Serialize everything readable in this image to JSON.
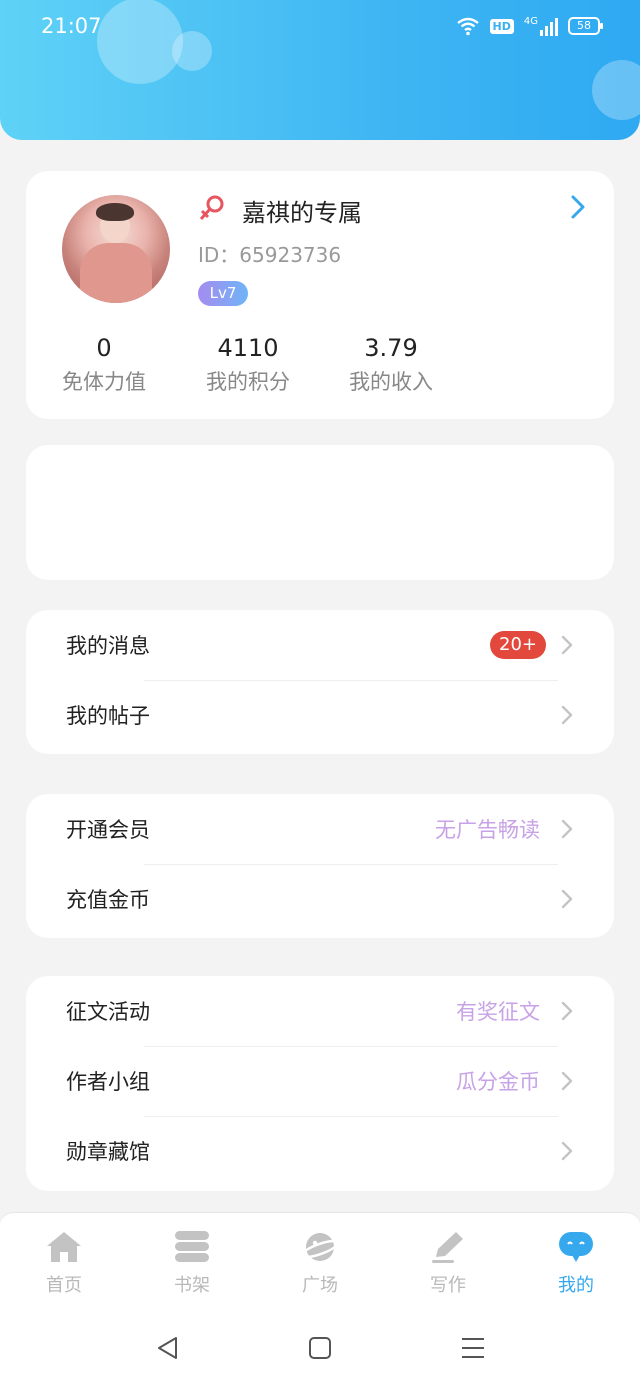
{
  "status_bar": {
    "time": "21:07",
    "hd": "HD",
    "network": "4G",
    "battery": "58"
  },
  "profile": {
    "nickname": "嘉祺的专属",
    "user_id": "ID：65923736",
    "level": "Lv7",
    "stats": [
      {
        "value": "0",
        "label": "免体力值"
      },
      {
        "value": "4110",
        "label": "我的积分"
      },
      {
        "value": "3.79",
        "label": "我的收入"
      }
    ]
  },
  "menu_groups": [
    {
      "items": [
        {
          "label": "我的消息",
          "badge": "20+"
        },
        {
          "label": "我的帖子"
        }
      ]
    },
    {
      "items": [
        {
          "label": "开通会员",
          "hint": "无广告畅读"
        },
        {
          "label": "充值金币"
        }
      ]
    },
    {
      "items": [
        {
          "label": "征文活动",
          "hint": "有奖征文"
        },
        {
          "label": "作者小组",
          "hint": "瓜分金币"
        },
        {
          "label": "勋章藏馆"
        }
      ]
    }
  ],
  "tabs": [
    {
      "label": "首页",
      "icon": "home-icon"
    },
    {
      "label": "书架",
      "icon": "bookshelf-icon"
    },
    {
      "label": "广场",
      "icon": "planet-icon"
    },
    {
      "label": "写作",
      "icon": "pen-icon"
    },
    {
      "label": "我的",
      "icon": "chat-bubble-icon",
      "active": true
    }
  ],
  "colors": {
    "header_gradient": [
      "#5fd2f6",
      "#2ea9f2"
    ],
    "accent": "#36a9ee",
    "hint": "#c7a2e6",
    "badge": "#e2483b"
  }
}
